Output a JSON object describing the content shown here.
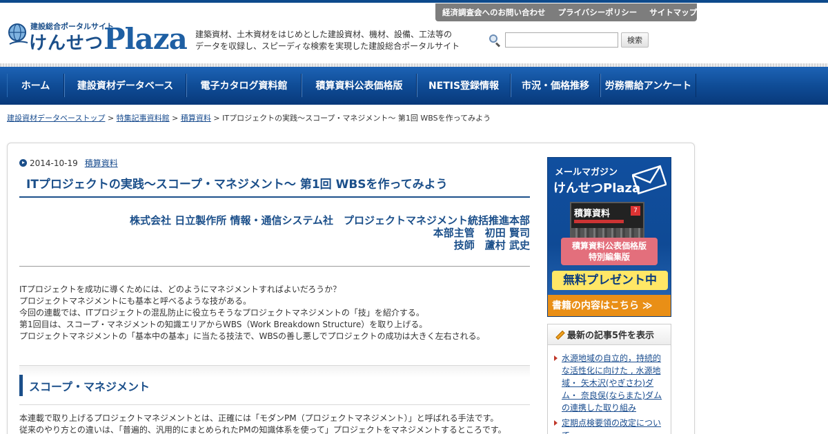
{
  "header": {
    "logo_small": "建設総合ポータルサイト",
    "logo_kana": "けんせつ",
    "logo_plaza": "Plaza",
    "tagline_line1": "建築資材、土木資材をはじめとした建設資材、機材、設備、工法等の",
    "tagline_line2": "データを収録し、スピーディな検索を実現した建設総合ポータルサイト",
    "top_links": [
      "経済調査会へのお問い合わせ",
      "プライバシーポリシー",
      "サイトマップ"
    ],
    "search_button": "検索",
    "search_value": ""
  },
  "nav": {
    "items": [
      {
        "label": "ホーム"
      },
      {
        "label": "建設資材データベース"
      },
      {
        "label": "電子カタログ資料館"
      },
      {
        "label": "積算資料公表価格版"
      },
      {
        "label": "NETIS登録情報"
      },
      {
        "label": "市況・価格推移"
      },
      {
        "label": "労務需給アンケート"
      }
    ]
  },
  "breadcrumb": {
    "items": [
      "建設資材データベーストップ",
      "特集記事資料館",
      "積算資料"
    ],
    "separator": ">",
    "current": "ITプロジェクトの実践～スコープ・マネジメント～ 第1回 WBSを作ってみよう"
  },
  "article": {
    "date": "2014-10-19",
    "category": "積算資料",
    "title": "ITプロジェクトの実践～スコープ・マネジメント～ 第1回 WBSを作ってみよう",
    "author_line1": "株式会社 日立製作所 情報・通信システム社　プロジェクトマネジメント統括推進本部",
    "author_line2": "本部主管　初田 賢司",
    "author_line3": "技師　蘆村 武史",
    "intro": [
      "ITプロジェクトを成功に導くためには、どのようにマネジメントすればよいだろうか？",
      "プロジェクトマネジメントにも基本と呼べるような技がある。",
      "今回の連載では、ITプロジェクトの混乱防止に役立ちそうなプロジェクトマネジメントの「技」を紹介する。",
      "第1回目は、スコープ・マネジメントの知識エリアからWBS（Work Breakdown Structure）を取り上げる。",
      "プロジェクトマネジメントの「基本中の基本」に当たる技法で、WBSの善し悪しでプロジェクトの成功は大きく左右される。"
    ],
    "section_title": "スコープ・マネジメント",
    "section_body": [
      "本連載で取り上げるプロジェクトマネジメントとは、正確には「モダンPM（プロジェクトマネジメント）」と呼ばれる手法です。",
      "従来のやり方との違いは、「普遍的、汎用的にまとめられたPMの知識体系を使って」プロジェクトをマネジメントするところです。"
    ]
  },
  "sidebar": {
    "banner": {
      "line1": "メールマガジン",
      "line2": "けんせつPlaza",
      "book_title": "積算資料",
      "book_sub": "公表価格版",
      "book_num": "7",
      "pink_line1": "積算資料公表価格版",
      "pink_line2": "特別編集版",
      "free": "無料プレゼント中",
      "more": "書籍の内容はこちら ≫"
    },
    "recent": {
      "title": "最新の記事5件を表示",
      "items": [
        "水源地域の自立的，持続的な活性化に向けた , 水源地域・ 矢木沢(やぎさわ)ダム・ 奈良俣(ならまた)ダムの連携した取り組み",
        "定期点検要領の改定について"
      ]
    }
  },
  "colors": {
    "brand_blue": "#1b4f8a",
    "nav_blue": "#0f4c96",
    "link_blue": "#1a4d8f",
    "top_links_bg": "#7d7d7d"
  }
}
